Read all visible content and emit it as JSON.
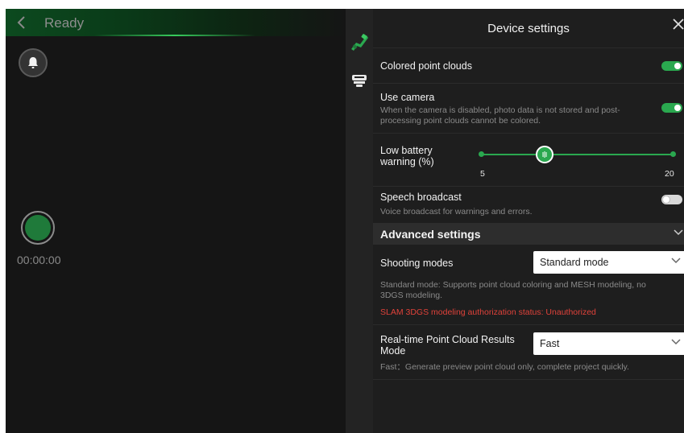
{
  "header": {
    "status": "Ready",
    "timer": "00:00:00"
  },
  "icons": {
    "back": "chevron-left-icon",
    "bell": "bell-icon",
    "record": "record-icon",
    "scanner": "scanner-icon",
    "device": "device-icon",
    "close": "close-icon"
  },
  "colors": {
    "accent": "#2aa84f",
    "panel_bg": "#1e1e1e",
    "warning": "#e0423a"
  },
  "settings": {
    "title": "Device settings",
    "colored_point_clouds": {
      "label": "Colored point clouds",
      "enabled": true
    },
    "use_camera": {
      "label": "Use camera",
      "description": "When the camera is disabled, photo data is not stored and post-processing point clouds cannot be colored.",
      "enabled": true
    },
    "low_battery": {
      "label": "Low battery warning (%)",
      "min_label": "5",
      "max_label": "20",
      "min": 5,
      "max": 20,
      "value": 10
    },
    "speech_broadcast": {
      "label": "Speech broadcast",
      "description": "Voice broadcast for warnings and errors.",
      "enabled": false
    },
    "advanced": {
      "title": "Advanced settings",
      "shooting_modes": {
        "label": "Shooting modes",
        "value": "Standard mode",
        "description": "Standard mode: Supports point cloud coloring and MESH modeling, no 3DGS modeling.",
        "auth_status": "SLAM 3DGS modeling authorization status: Unauthorized"
      },
      "realtime_mode": {
        "label": "Real-time Point Cloud Results Mode",
        "value": "Fast",
        "description": "Fast：Generate preview point cloud only, complete project quickly."
      }
    }
  }
}
